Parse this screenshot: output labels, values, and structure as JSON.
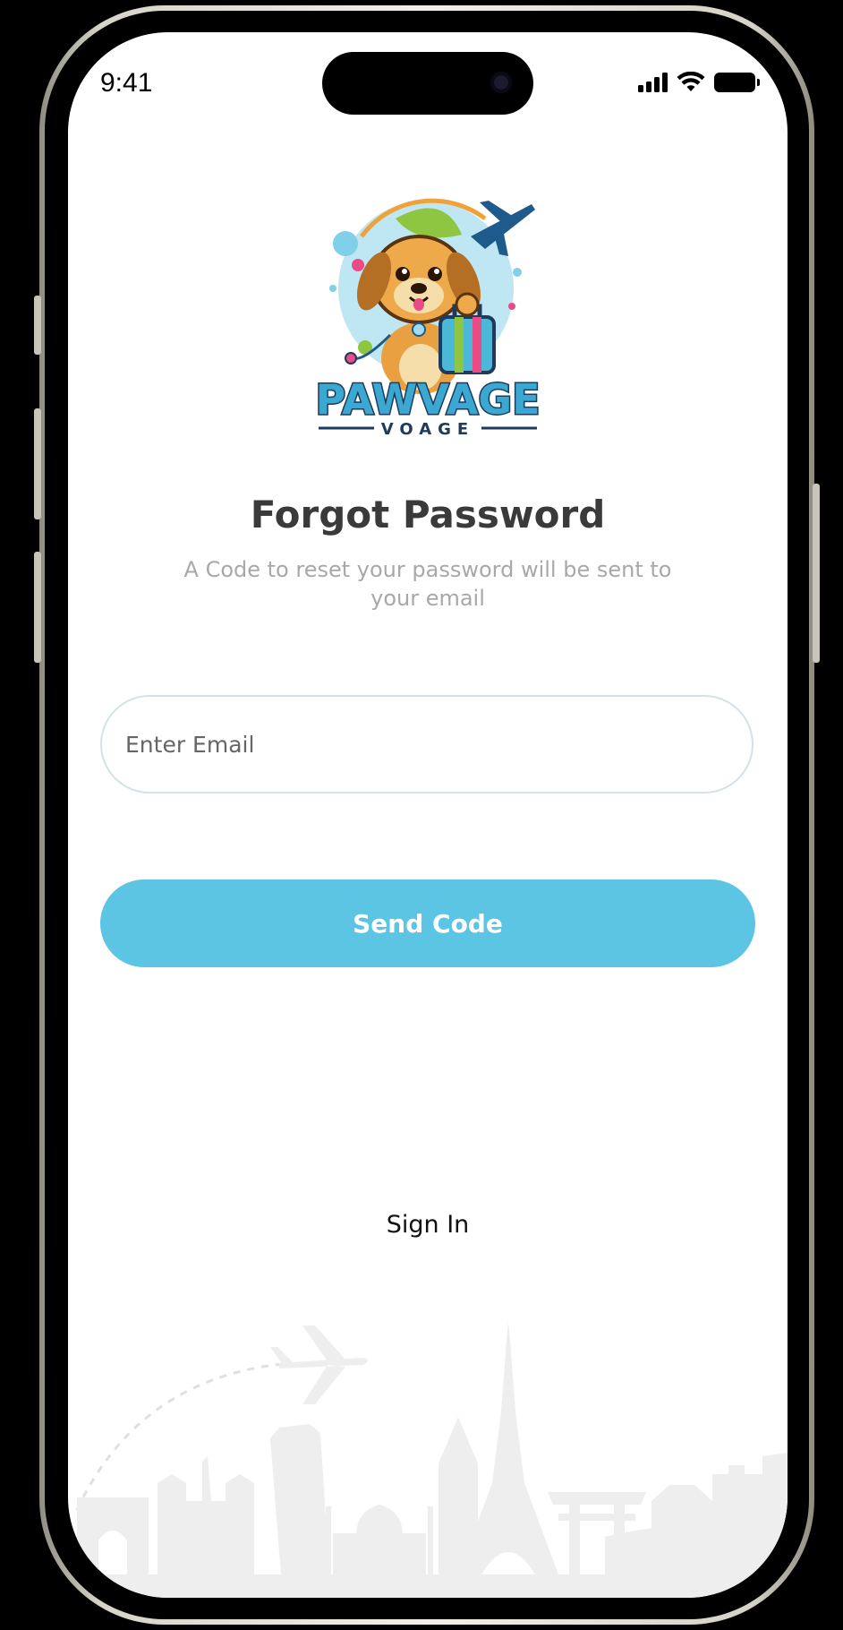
{
  "status_bar": {
    "time": "9:41"
  },
  "logo": {
    "brand": "PAWVAGE",
    "tagline": "VOAGE"
  },
  "page": {
    "title": "Forgot Password",
    "subtitle": "A Code to reset your password will be sent to your email"
  },
  "form": {
    "email_placeholder": "Enter Email",
    "email_value": "",
    "send_label": "Send Code"
  },
  "footer": {
    "sign_in_label": "Sign In"
  },
  "colors": {
    "accent": "#5cc5e3",
    "title": "#3a3a3a",
    "subtitle": "#a8a8a8",
    "input_border": "#d2e3e8",
    "skyline": "#eeeeee"
  },
  "icons": {
    "signal": "cellular-signal-icon",
    "wifi": "wifi-icon",
    "battery": "battery-icon",
    "logo": "dog-traveler-logo",
    "background": "world-landmarks-skyline"
  }
}
